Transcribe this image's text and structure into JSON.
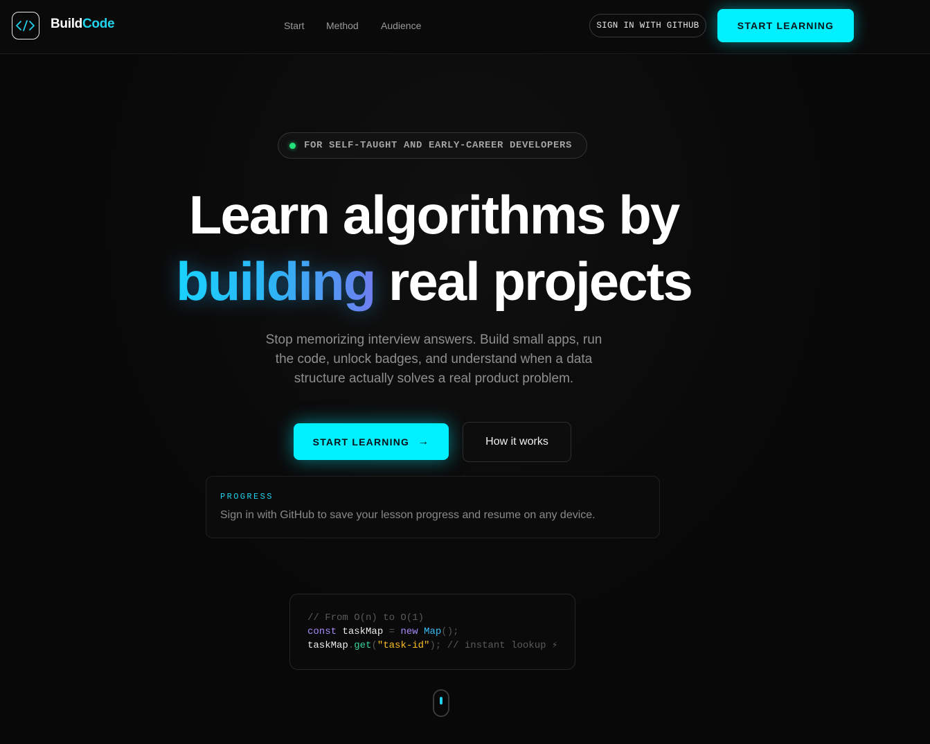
{
  "header": {
    "brand_part1": "Build",
    "brand_part2": "Code",
    "logo_icon": "code-brackets-icon",
    "nav": [
      "Start",
      "Method",
      "Audience"
    ],
    "github_button": "SIGN IN WITH GITHUB",
    "start_button": "START LEARNING"
  },
  "hero": {
    "pill": "FOR SELF-TAUGHT AND EARLY-CAREER DEVELOPERS",
    "title_line1": "Learn algorithms by",
    "title_highlight": "building",
    "title_rest": " real projects",
    "subtitle": "Stop memorizing interview answers. Build small apps, run the code, unlock badges, and understand when a data structure actually solves a real product problem.",
    "cta_primary": "START LEARNING",
    "cta_primary_icon": "→",
    "cta_secondary": "How it works"
  },
  "progress": {
    "label": "PROGRESS",
    "text": "Sign in with GitHub to save your lesson progress and resume on any device."
  },
  "code": {
    "comment": "// From O(n) to O(1)",
    "line2": {
      "kw": "const",
      "id": "taskMap",
      "op": "=",
      "new": "new",
      "cls": "Map",
      "end": "();"
    },
    "line3": {
      "id": "taskMap",
      "dot": ".",
      "fn": "get",
      "open": "(",
      "str": "\"task-id\"",
      "close": ");",
      "comment": "// instant lookup ⚡"
    }
  },
  "colors": {
    "accent": "#00f0ff",
    "brand_accent": "#22d3ee",
    "status_dot": "#22e07a",
    "background": "#080808"
  }
}
